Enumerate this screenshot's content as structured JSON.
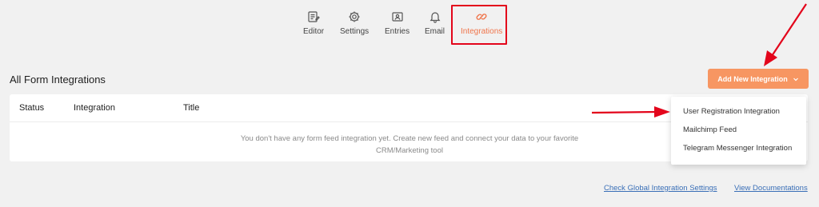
{
  "nav": {
    "items": [
      {
        "label": "Editor",
        "icon": "editor-icon"
      },
      {
        "label": "Settings",
        "icon": "settings-icon"
      },
      {
        "label": "Entries",
        "icon": "entries-icon"
      },
      {
        "label": "Email",
        "icon": "bell-icon"
      },
      {
        "label": "Integrations",
        "icon": "link-icon",
        "active": true
      }
    ]
  },
  "header": {
    "title": "All Form Integrations",
    "add_button_label": "Add New Integration"
  },
  "table": {
    "columns": [
      "Status",
      "Integration",
      "Title"
    ],
    "empty_line_1": "You don't have any form feed integration yet. Create new feed and connect your data to your favorite",
    "empty_line_2": "CRM/Marketing tool"
  },
  "dropdown": {
    "options": [
      "User Registration Integration",
      "Mailchimp Feed",
      "Telegram Messenger Integration"
    ]
  },
  "footer": {
    "global_settings_link": "Check Global Integration Settings",
    "docs_link": "View Documentations"
  },
  "colors": {
    "accent": "#f0754b",
    "button": "#f79662",
    "highlight_border": "#e3051b",
    "link": "#3a6fb7"
  }
}
